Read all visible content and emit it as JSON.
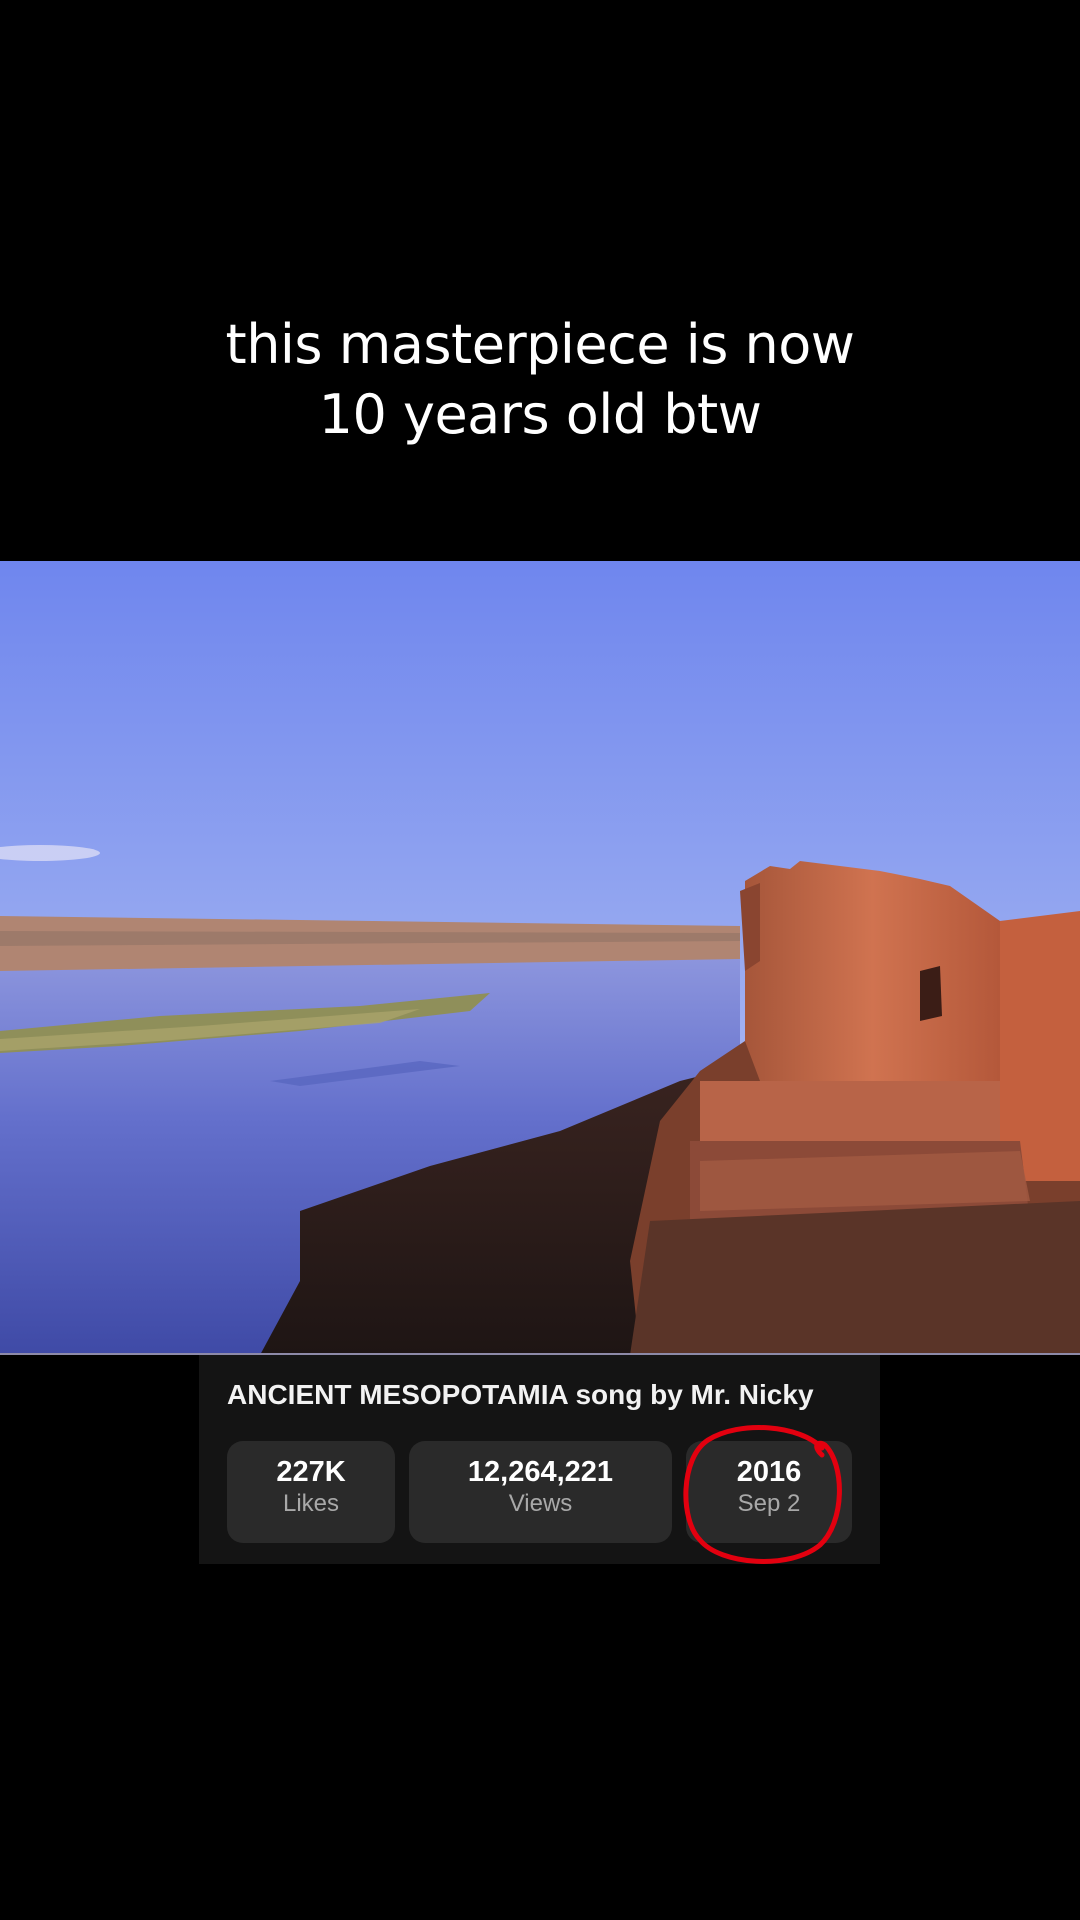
{
  "caption": {
    "line1": "this masterpiece is now",
    "line2": "10 years old btw"
  },
  "video": {
    "scene": "river-and-ancient-ruins",
    "colors": {
      "sky_top": "#6f86ee",
      "sky_bottom": "#c9d0f5",
      "river": "#5a65c8",
      "ruin": "#c56a48"
    }
  },
  "card": {
    "title": "ANCIENT MESOPOTAMIA song by Mr. Nicky",
    "stats": [
      {
        "value": "227K",
        "label": "Likes"
      },
      {
        "value": "12,264,221",
        "label": "Views"
      },
      {
        "value": "2016",
        "label": "Sep 2"
      }
    ]
  },
  "annotation": {
    "type": "hand-drawn-circle",
    "color": "#e3000f",
    "target": "date-stat"
  }
}
